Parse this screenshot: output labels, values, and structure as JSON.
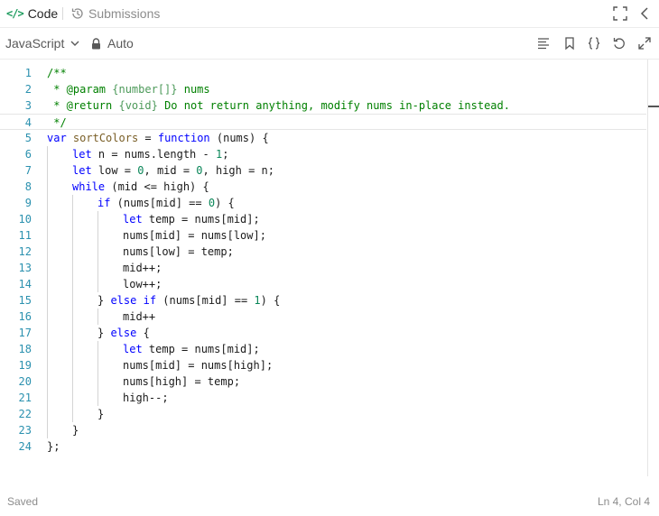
{
  "tabs": {
    "code_label": "Code",
    "submissions_label": "Submissions"
  },
  "toolbar": {
    "language": "JavaScript",
    "auto_label": "Auto"
  },
  "editor": {
    "lines": [
      {
        "n": "1",
        "indent": 0,
        "tokens": [
          {
            "t": "/**",
            "c": "cmt"
          }
        ]
      },
      {
        "n": "2",
        "indent": 0,
        "tokens": [
          {
            "t": " * @param ",
            "c": "cmt"
          },
          {
            "t": "{number[]}",
            "c": "cmt-type"
          },
          {
            "t": " nums",
            "c": "cmt"
          }
        ]
      },
      {
        "n": "3",
        "indent": 0,
        "tokens": [
          {
            "t": " * @return ",
            "c": "cmt"
          },
          {
            "t": "{void}",
            "c": "cmt-type"
          },
          {
            "t": " Do not return anything, modify nums in-place instead.",
            "c": "cmt"
          }
        ]
      },
      {
        "n": "4",
        "indent": 0,
        "tokens": [
          {
            "t": " */",
            "c": "cmt"
          }
        ]
      },
      {
        "n": "5",
        "indent": 0,
        "tokens": [
          {
            "t": "var",
            "c": "kw"
          },
          {
            "t": " ",
            "c": "id"
          },
          {
            "t": "sortColors",
            "c": "fn"
          },
          {
            "t": " = ",
            "c": "id"
          },
          {
            "t": "function",
            "c": "kw"
          },
          {
            "t": " (nums) {",
            "c": "id"
          }
        ]
      },
      {
        "n": "6",
        "indent": 1,
        "tokens": [
          {
            "t": "let",
            "c": "kw"
          },
          {
            "t": " n = nums.length - ",
            "c": "id"
          },
          {
            "t": "1",
            "c": "num"
          },
          {
            "t": ";",
            "c": "id"
          }
        ]
      },
      {
        "n": "7",
        "indent": 1,
        "tokens": [
          {
            "t": "let",
            "c": "kw"
          },
          {
            "t": " low = ",
            "c": "id"
          },
          {
            "t": "0",
            "c": "num"
          },
          {
            "t": ", mid = ",
            "c": "id"
          },
          {
            "t": "0",
            "c": "num"
          },
          {
            "t": ", high = n;",
            "c": "id"
          }
        ]
      },
      {
        "n": "8",
        "indent": 1,
        "tokens": [
          {
            "t": "while",
            "c": "kw"
          },
          {
            "t": " (mid <= high) {",
            "c": "id"
          }
        ]
      },
      {
        "n": "9",
        "indent": 2,
        "tokens": [
          {
            "t": "if",
            "c": "kw"
          },
          {
            "t": " (nums[mid] == ",
            "c": "id"
          },
          {
            "t": "0",
            "c": "num"
          },
          {
            "t": ") {",
            "c": "id"
          }
        ]
      },
      {
        "n": "10",
        "indent": 3,
        "tokens": [
          {
            "t": "let",
            "c": "kw"
          },
          {
            "t": " temp = nums[mid];",
            "c": "id"
          }
        ]
      },
      {
        "n": "11",
        "indent": 3,
        "tokens": [
          {
            "t": "nums[mid] = nums[low];",
            "c": "id"
          }
        ]
      },
      {
        "n": "12",
        "indent": 3,
        "tokens": [
          {
            "t": "nums[low] = temp;",
            "c": "id"
          }
        ]
      },
      {
        "n": "13",
        "indent": 3,
        "tokens": [
          {
            "t": "mid++;",
            "c": "id"
          }
        ]
      },
      {
        "n": "14",
        "indent": 3,
        "tokens": [
          {
            "t": "low++;",
            "c": "id"
          }
        ]
      },
      {
        "n": "15",
        "indent": 2,
        "tokens": [
          {
            "t": "} ",
            "c": "id"
          },
          {
            "t": "else",
            "c": "kw"
          },
          {
            "t": " ",
            "c": "id"
          },
          {
            "t": "if",
            "c": "kw"
          },
          {
            "t": " (nums[mid] == ",
            "c": "id"
          },
          {
            "t": "1",
            "c": "num"
          },
          {
            "t": ") {",
            "c": "id"
          }
        ]
      },
      {
        "n": "16",
        "indent": 3,
        "tokens": [
          {
            "t": "mid++",
            "c": "id"
          }
        ]
      },
      {
        "n": "17",
        "indent": 2,
        "tokens": [
          {
            "t": "} ",
            "c": "id"
          },
          {
            "t": "else",
            "c": "kw"
          },
          {
            "t": " {",
            "c": "id"
          }
        ]
      },
      {
        "n": "18",
        "indent": 3,
        "tokens": [
          {
            "t": "let",
            "c": "kw"
          },
          {
            "t": " temp = nums[mid];",
            "c": "id"
          }
        ]
      },
      {
        "n": "19",
        "indent": 3,
        "tokens": [
          {
            "t": "nums[mid] = nums[high];",
            "c": "id"
          }
        ]
      },
      {
        "n": "20",
        "indent": 3,
        "tokens": [
          {
            "t": "nums[high] = temp;",
            "c": "id"
          }
        ]
      },
      {
        "n": "21",
        "indent": 3,
        "tokens": [
          {
            "t": "high--;",
            "c": "id"
          }
        ]
      },
      {
        "n": "22",
        "indent": 2,
        "tokens": [
          {
            "t": "}",
            "c": "id"
          }
        ]
      },
      {
        "n": "23",
        "indent": 1,
        "tokens": [
          {
            "t": "}",
            "c": "id"
          }
        ]
      },
      {
        "n": "24",
        "indent": 0,
        "tokens": [
          {
            "t": "};",
            "c": "id"
          }
        ]
      }
    ],
    "active_line": 4
  },
  "status": {
    "saved": "Saved",
    "cursor": "Ln 4, Col 4"
  },
  "icons": {
    "code_tab": "code-icon",
    "submissions_tab": "history-icon",
    "expand": "fullscreen-icon",
    "collapse": "chevron-left-icon",
    "lock": "lock-icon",
    "format": "align-left-icon",
    "bookmark": "bookmark-icon",
    "braces": "braces-icon",
    "reset": "reset-icon",
    "maximize": "expand-arrows-icon"
  },
  "colors": {
    "code_tab_accent": "#1c9b5d",
    "keyword": "#0000ff",
    "comment": "#008000",
    "number": "#098658",
    "function": "#795e26",
    "line_number": "#2b91af"
  }
}
